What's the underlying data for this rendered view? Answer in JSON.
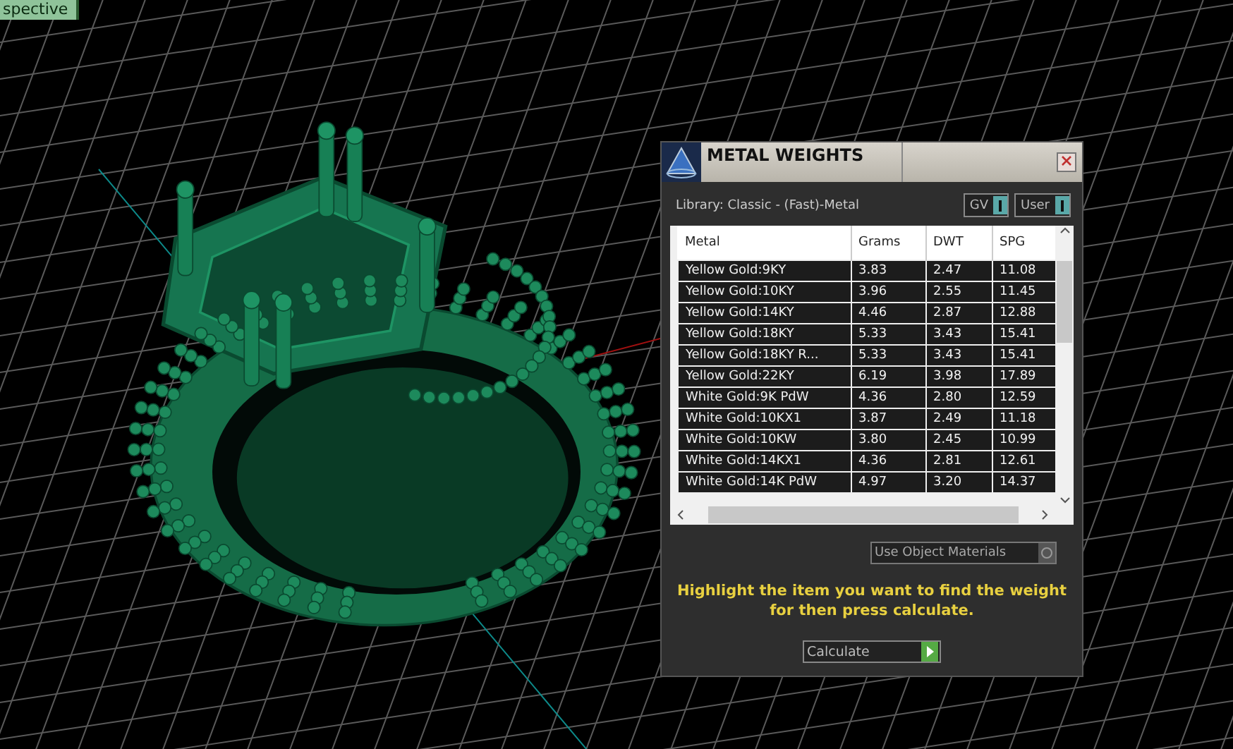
{
  "viewport": {
    "label": "spective"
  },
  "dialog": {
    "title": "METAL WEIGHTS",
    "library": "Library: Classic - (Fast)-Metal",
    "toggles": [
      {
        "label": "GV",
        "on": true
      },
      {
        "label": "User",
        "on": true
      }
    ],
    "table": {
      "columns": [
        "Metal",
        "Grams",
        "DWT",
        "SPG"
      ],
      "rows": [
        {
          "cells": [
            "Yellow Gold:9KY",
            "3.83",
            "2.47",
            "11.08"
          ],
          "selected": false
        },
        {
          "cells": [
            "Yellow Gold:10KY",
            "3.96",
            "2.55",
            "11.45"
          ],
          "selected": false
        },
        {
          "cells": [
            "Yellow Gold:14KY",
            "4.46",
            "2.87",
            "12.88"
          ],
          "selected": false
        },
        {
          "cells": [
            "Yellow Gold:18KY",
            "5.33",
            "3.43",
            "15.41"
          ],
          "selected": false
        },
        {
          "cells": [
            "Yellow Gold:18KY R...",
            "5.33",
            "3.43",
            "15.41"
          ],
          "selected": false
        },
        {
          "cells": [
            "Yellow Gold:22KY",
            "6.19",
            "3.98",
            "17.89"
          ],
          "selected": false
        },
        {
          "cells": [
            "White Gold:9K PdW",
            "4.36",
            "2.80",
            "12.59"
          ],
          "selected": false
        },
        {
          "cells": [
            "White Gold:10KX1",
            "3.87",
            "2.49",
            "11.18"
          ],
          "selected": false
        },
        {
          "cells": [
            "White Gold:10KW",
            "3.80",
            "2.45",
            "10.99"
          ],
          "selected": false
        },
        {
          "cells": [
            "White Gold:14KX1",
            "4.36",
            "2.81",
            "12.61"
          ],
          "selected": false
        },
        {
          "cells": [
            "White Gold:14K PdW",
            "4.97",
            "3.20",
            "14.37"
          ],
          "selected": false
        }
      ]
    },
    "materials": {
      "label": "Use Object Materials",
      "checked": false
    },
    "instruction": "Highlight the item you want to find the weight for then press calculate.",
    "calculate": {
      "label": "Calculate"
    }
  }
}
